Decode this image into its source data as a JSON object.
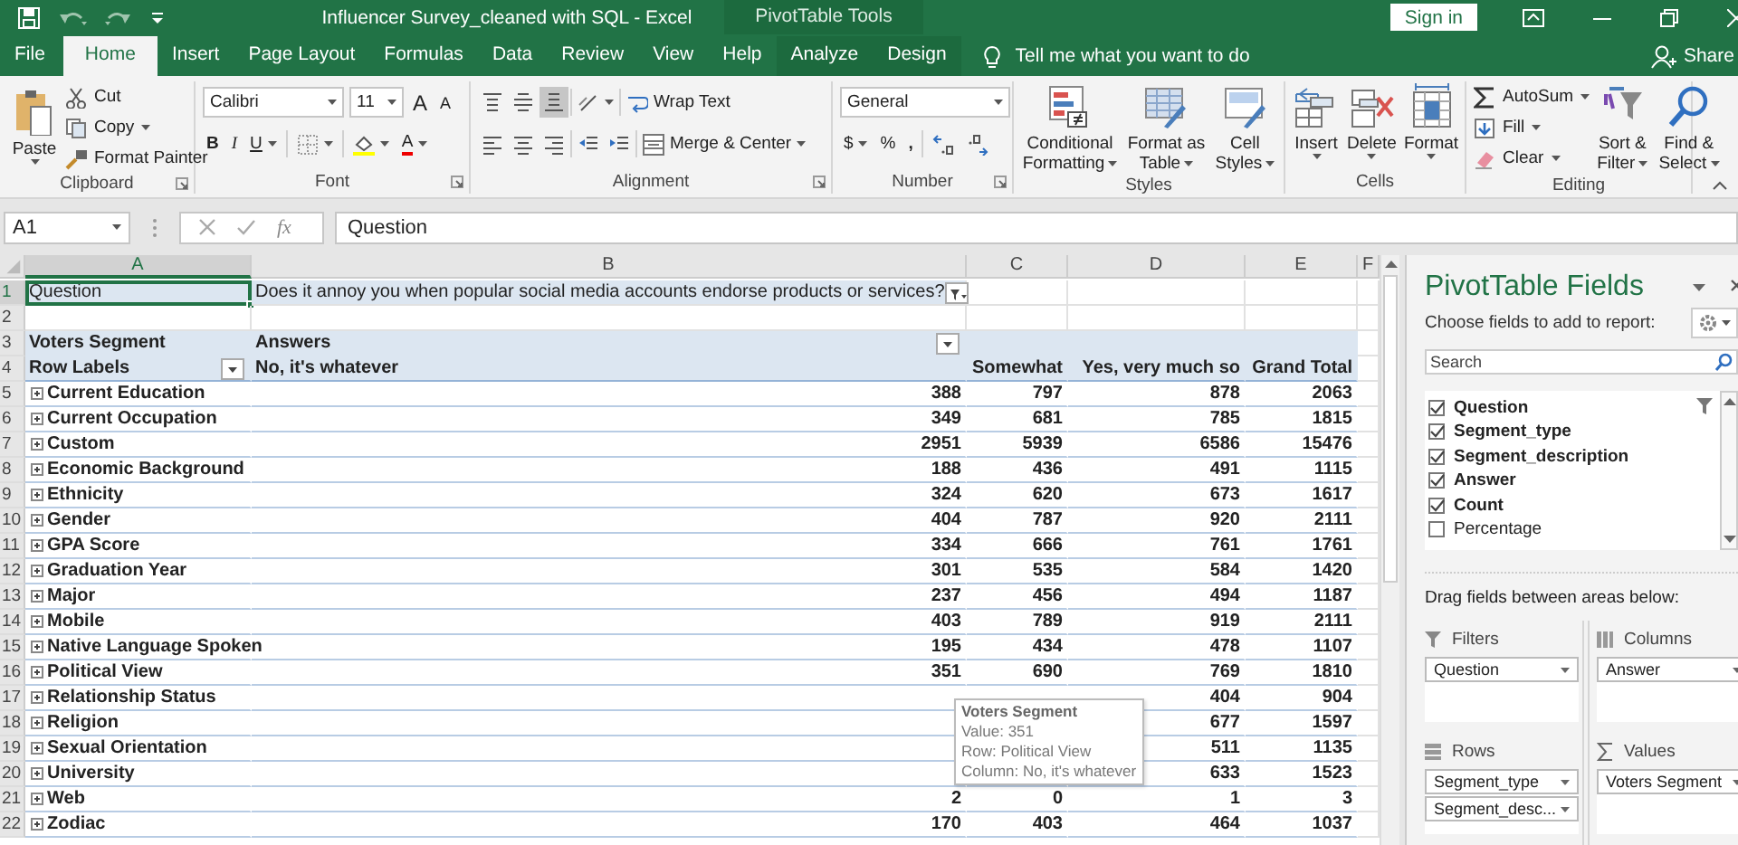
{
  "title_bar": {
    "title": "Influencer Survey_cleaned with SQL  -  Excel",
    "context_label": "PivotTable Tools",
    "sign_in": "Sign in"
  },
  "tabs": [
    {
      "label": "File",
      "selected": false,
      "kind": "main"
    },
    {
      "label": "Home",
      "selected": true,
      "kind": "main"
    },
    {
      "label": "Insert",
      "selected": false,
      "kind": "main"
    },
    {
      "label": "Page Layout",
      "selected": false,
      "kind": "main"
    },
    {
      "label": "Formulas",
      "selected": false,
      "kind": "main"
    },
    {
      "label": "Data",
      "selected": false,
      "kind": "main"
    },
    {
      "label": "Review",
      "selected": false,
      "kind": "main"
    },
    {
      "label": "View",
      "selected": false,
      "kind": "main"
    },
    {
      "label": "Help",
      "selected": false,
      "kind": "main"
    },
    {
      "label": "Analyze",
      "selected": false,
      "kind": "context"
    },
    {
      "label": "Design",
      "selected": false,
      "kind": "context"
    }
  ],
  "tell_me": "Tell me what you want to do",
  "share": "Share",
  "ribbon": {
    "groups": [
      {
        "kind": "clipboard",
        "label": "Clipboard",
        "large": [
          {
            "lines": [
              "Paste"
            ]
          }
        ],
        "small": [
          {
            "label": "Cut",
            "has_menu": false
          },
          {
            "label": "Copy",
            "has_menu": true
          },
          {
            "label": "Format Painter",
            "has_menu": false
          }
        ]
      },
      {
        "kind": "font",
        "label": "Font",
        "font_name": "Calibri",
        "font_size": "11",
        "grow": "A",
        "shrink": "A",
        "bold": "B",
        "italic": "I",
        "underline": "U",
        "font_color": "A"
      },
      {
        "kind": "alignment",
        "label": "Alignment",
        "wrap_text": "Wrap Text",
        "merge": "Merge & Center"
      },
      {
        "kind": "number",
        "label": "Number",
        "format": "General",
        "currency": "$",
        "percent": "%",
        "comma": ","
      },
      {
        "kind": "styles",
        "label": "Styles",
        "large": [
          {
            "lines": [
              "Conditional",
              "Formatting"
            ]
          },
          {
            "lines": [
              "Format as",
              "Table"
            ]
          },
          {
            "lines": [
              "Cell",
              "Styles"
            ]
          }
        ]
      },
      {
        "kind": "cells",
        "label": "Cells",
        "large": [
          {
            "lines": [
              "Insert"
            ]
          },
          {
            "lines": [
              "Delete"
            ]
          },
          {
            "lines": [
              "Format"
            ]
          }
        ]
      },
      {
        "kind": "editing",
        "label": "Editing",
        "small": [
          {
            "label": "AutoSum",
            "has_menu": true
          },
          {
            "label": "Fill",
            "has_menu": true
          },
          {
            "label": "Clear",
            "has_menu": true
          }
        ],
        "large": [
          {
            "lines": [
              "Sort &",
              "Filter"
            ]
          },
          {
            "lines": [
              "Find &",
              "Select"
            ]
          }
        ]
      }
    ]
  },
  "formula_bar": {
    "name_box": "A1",
    "function_label": "fx",
    "formula": "Question"
  },
  "sheet": {
    "columns": [
      {
        "label": "A",
        "selected": true
      },
      {
        "label": "B",
        "selected": false
      },
      {
        "label": "C",
        "selected": false
      },
      {
        "label": "D",
        "selected": false
      },
      {
        "label": "E",
        "selected": false
      },
      {
        "label": "F",
        "selected": false
      }
    ],
    "rows": [
      {
        "number": "1",
        "selected": true,
        "kind": "filter",
        "label": "Question",
        "value": "Does it annoy you when popular social media accounts endorse products or services?"
      },
      {
        "number": "2",
        "selected": false,
        "kind": "blank"
      },
      {
        "number": "3",
        "selected": false,
        "kind": "header",
        "label": "Voters Segment",
        "value": "Answers"
      },
      {
        "number": "4",
        "selected": false,
        "kind": "labels",
        "label": "Row Labels",
        "values": [
          "No, it's whatever",
          "Somewhat",
          "Yes, very much so",
          "Grand Total"
        ]
      },
      {
        "number": "5",
        "selected": false,
        "kind": "data",
        "label": "Current Education",
        "values": [
          "388",
          "797",
          "878",
          "2063"
        ]
      },
      {
        "number": "6",
        "selected": false,
        "kind": "data",
        "label": "Current Occupation",
        "values": [
          "349",
          "681",
          "785",
          "1815"
        ]
      },
      {
        "number": "7",
        "selected": false,
        "kind": "data",
        "label": "Custom",
        "values": [
          "2951",
          "5939",
          "6586",
          "15476"
        ]
      },
      {
        "number": "8",
        "selected": false,
        "kind": "data",
        "label": "Economic Background",
        "values": [
          "188",
          "436",
          "491",
          "1115"
        ]
      },
      {
        "number": "9",
        "selected": false,
        "kind": "data",
        "label": "Ethnicity",
        "values": [
          "324",
          "620",
          "673",
          "1617"
        ]
      },
      {
        "number": "10",
        "selected": false,
        "kind": "data",
        "label": "Gender",
        "values": [
          "404",
          "787",
          "920",
          "2111"
        ]
      },
      {
        "number": "11",
        "selected": false,
        "kind": "data",
        "label": "GPA Score",
        "values": [
          "334",
          "666",
          "761",
          "1761"
        ]
      },
      {
        "number": "12",
        "selected": false,
        "kind": "data",
        "label": "Graduation Year",
        "values": [
          "301",
          "535",
          "584",
          "1420"
        ]
      },
      {
        "number": "13",
        "selected": false,
        "kind": "data",
        "label": "Major",
        "values": [
          "237",
          "456",
          "494",
          "1187"
        ]
      },
      {
        "number": "14",
        "selected": false,
        "kind": "data",
        "label": "Mobile",
        "values": [
          "403",
          "789",
          "919",
          "2111"
        ]
      },
      {
        "number": "15",
        "selected": false,
        "kind": "data",
        "label": "Native Language Spoken",
        "values": [
          "195",
          "434",
          "478",
          "1107"
        ]
      },
      {
        "number": "16",
        "selected": false,
        "kind": "data",
        "label": "Political View",
        "values": [
          "351",
          "690",
          "769",
          "1810"
        ]
      },
      {
        "number": "17",
        "selected": false,
        "kind": "data",
        "label": "Relationship Status",
        "values": [
          "404",
          "904"
        ]
      },
      {
        "number": "18",
        "selected": false,
        "kind": "data",
        "label": "Religion",
        "values": [
          "677",
          "1597"
        ]
      },
      {
        "number": "19",
        "selected": false,
        "kind": "data",
        "label": "Sexual Orientation",
        "values": [
          "511",
          "1135"
        ]
      },
      {
        "number": "20",
        "selected": false,
        "kind": "data",
        "label": "University",
        "values": [
          "633",
          "1523"
        ]
      },
      {
        "number": "21",
        "selected": false,
        "kind": "data",
        "label": "Web",
        "values": [
          "2",
          "0",
          "1",
          "3"
        ]
      },
      {
        "number": "22",
        "selected": false,
        "kind": "data",
        "label": "Zodiac",
        "values": [
          "170",
          "403",
          "464",
          "1037"
        ]
      }
    ],
    "tooltip": {
      "title": "Voters Segment",
      "lines": [
        "Value: 351",
        "Row: Political View",
        "Column: No, it's whatever"
      ]
    }
  },
  "pivot_panel": {
    "title": "PivotTable Fields",
    "subtitle": "Choose fields to add to report:",
    "search_placeholder": "Search",
    "fields": [
      {
        "label": "Question",
        "checked": true
      },
      {
        "label": "Segment_type",
        "checked": true
      },
      {
        "label": "Segment_description",
        "checked": true
      },
      {
        "label": "Answer",
        "checked": true
      },
      {
        "label": "Count",
        "checked": true
      },
      {
        "label": "Percentage",
        "checked": false
      }
    ],
    "drag_hint": "Drag fields between areas below:",
    "areas": [
      {
        "kind": "filters",
        "title": "Filters",
        "items": [
          "Question"
        ]
      },
      {
        "kind": "columns",
        "title": "Columns",
        "items": [
          "Answer"
        ]
      },
      {
        "kind": "rows",
        "title": "Rows",
        "items": [
          "Segment_type",
          "Segment_desc..."
        ]
      },
      {
        "kind": "values",
        "title": "Values",
        "items": [
          "Voters Segment"
        ]
      }
    ]
  }
}
